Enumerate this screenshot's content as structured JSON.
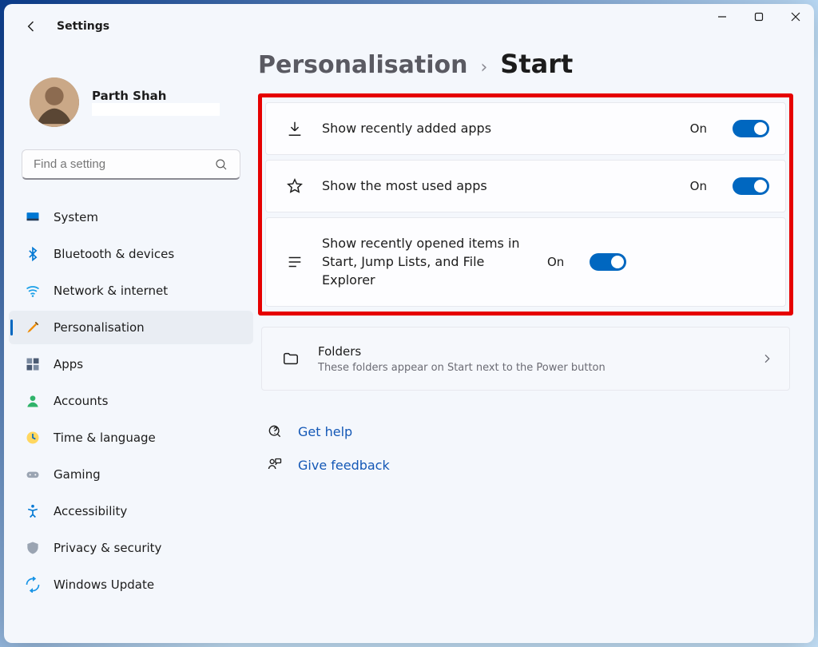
{
  "app_title": "Settings",
  "account": {
    "name": "Parth Shah",
    "email": ""
  },
  "search": {
    "placeholder": "Find a setting"
  },
  "nav": [
    {
      "label": "System"
    },
    {
      "label": "Bluetooth & devices"
    },
    {
      "label": "Network & internet"
    },
    {
      "label": "Personalisation"
    },
    {
      "label": "Apps"
    },
    {
      "label": "Accounts"
    },
    {
      "label": "Time & language"
    },
    {
      "label": "Gaming"
    },
    {
      "label": "Accessibility"
    },
    {
      "label": "Privacy & security"
    },
    {
      "label": "Windows Update"
    }
  ],
  "breadcrumb": {
    "parent": "Personalisation",
    "sep": "›",
    "current": "Start"
  },
  "toggles": [
    {
      "label": "Show recently added apps",
      "status": "On"
    },
    {
      "label": "Show the most used apps",
      "status": "On"
    },
    {
      "label": "Show recently opened items in Start, Jump Lists, and File Explorer",
      "status": "On"
    }
  ],
  "folders": {
    "title": "Folders",
    "subtitle": "These folders appear on Start next to the Power button"
  },
  "links": {
    "help": "Get help",
    "feedback": "Give feedback"
  }
}
